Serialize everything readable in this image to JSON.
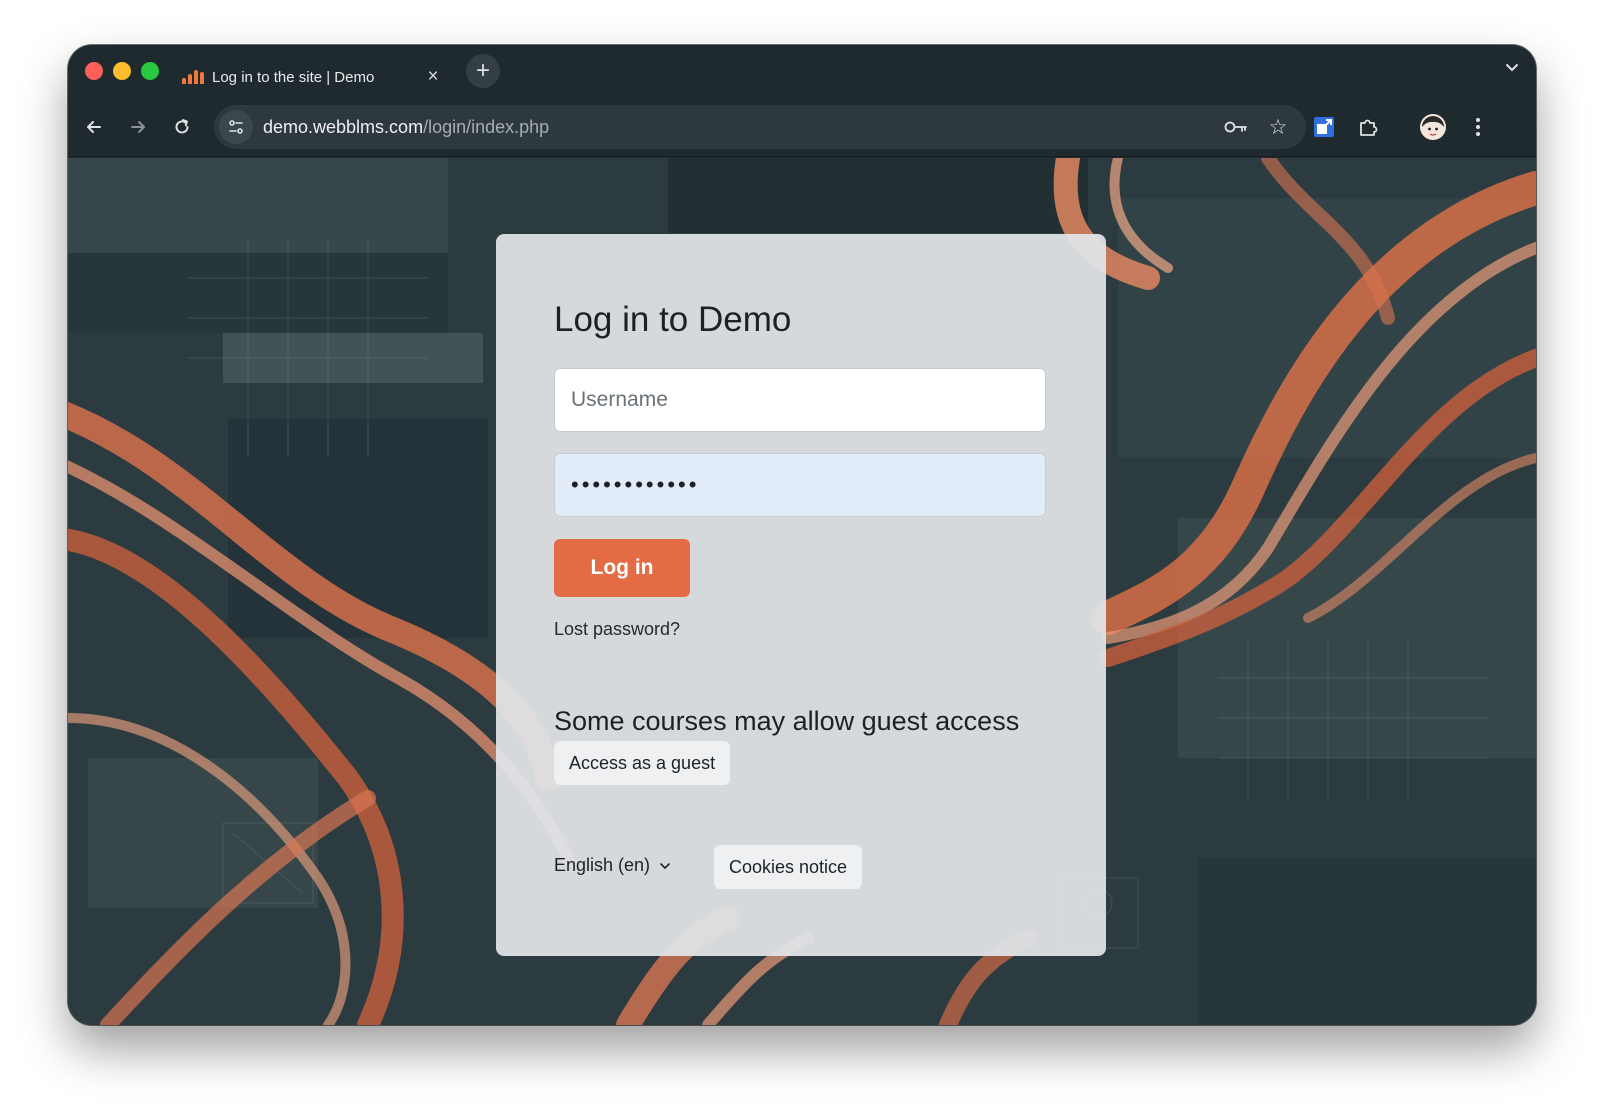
{
  "browser": {
    "tab_title": "Log in to the site | Demo",
    "tab_close": "×",
    "new_tab": "+",
    "url_host": "demo.webblms.com",
    "url_path": "/login/index.php"
  },
  "login": {
    "heading": "Log in to Demo",
    "username_placeholder": "Username",
    "password_value": "••••••••••••",
    "login_button": "Log in",
    "lost_password": "Lost password?"
  },
  "guest": {
    "heading": "Some courses may allow guest access",
    "button": "Access as a guest"
  },
  "footer": {
    "language": "English (en)",
    "cookies_button": "Cookies notice"
  },
  "colors": {
    "accent": "#e36c44",
    "autofill_bg": "#e2ebf8",
    "browser_chrome": "#1f2a2f"
  }
}
